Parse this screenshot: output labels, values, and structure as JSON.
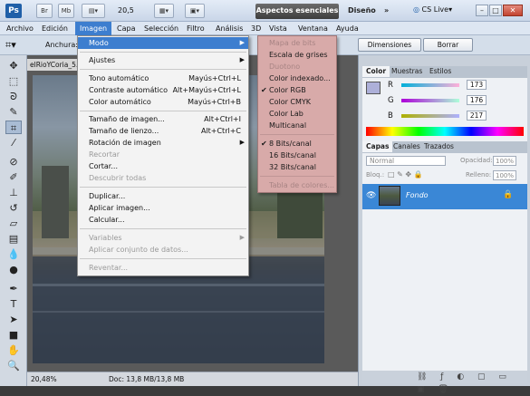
{
  "appbar": {
    "logo": "Ps",
    "btn1": "Br",
    "btn2": "Mb",
    "zoom": "20,5",
    "workspace_active": "Aspectos esenciales",
    "workspace_other": "Diseño",
    "more": "»",
    "cslive": "CS Live"
  },
  "menubar": [
    "Archivo",
    "Edición",
    "Imagen",
    "Capa",
    "Selección",
    "Filtro",
    "Análisis",
    "3D",
    "Vista",
    "Ventana",
    "Ayuda"
  ],
  "options": {
    "anchura_label": "Anchura:",
    "dimensiones": "Dimensiones",
    "borrar": "Borrar"
  },
  "document": {
    "tab_title": "elRioYCoria_5...",
    "zoom_pct": "20,48%",
    "doc_info": "Doc: 13,8 MB/13,8 MB"
  },
  "image_menu": {
    "modo": "Modo",
    "ajustes": "Ajustes",
    "tono": "Tono automático",
    "tono_sc": "Mayús+Ctrl+L",
    "contraste": "Contraste automático",
    "contraste_sc": "Alt+Mayús+Ctrl+L",
    "color": "Color automático",
    "color_sc": "Mayús+Ctrl+B",
    "tam_imagen": "Tamaño de imagen...",
    "tam_imagen_sc": "Alt+Ctrl+I",
    "tam_lienzo": "Tamaño de lienzo...",
    "tam_lienzo_sc": "Alt+Ctrl+C",
    "rotacion": "Rotación de imagen",
    "recortar": "Recortar",
    "cortar": "Cortar...",
    "descubrir": "Descubrir todas",
    "duplicar": "Duplicar...",
    "aplicar_imagen": "Aplicar imagen...",
    "calcular": "Calcular...",
    "variables": "Variables",
    "aplicar_conjunto": "Aplicar conjunto de datos...",
    "reventar": "Reventar..."
  },
  "mode_menu": {
    "mapa_bits": "Mapa de bits",
    "escala_grises": "Escala de grises",
    "duotono": "Duotono",
    "color_indexado": "Color indexado...",
    "rgb": "Color RGB",
    "cmyk": "Color CMYK",
    "lab": "Color Lab",
    "multicanal": "Multicanal",
    "bits8": "8 Bits/canal",
    "bits16": "16 Bits/canal",
    "bits32": "32 Bits/canal",
    "tabla": "Tabla de colores...",
    "check": "✔"
  },
  "color_panel": {
    "tabs": [
      "Color",
      "Muestras",
      "Estilos"
    ],
    "r_label": "R",
    "r_value": "173",
    "g_label": "G",
    "g_value": "176",
    "b_label": "B",
    "b_value": "217",
    "swatch_color": "#adb0d9"
  },
  "layers_panel": {
    "tabs": [
      "Capas",
      "Canales",
      "Trazados"
    ],
    "blend_mode": "Normal",
    "opacity_label": "Opacidad:",
    "opacity_value": "100%",
    "lock_label": "Bloq.:",
    "fill_label": "Relleno:",
    "fill_value": "100%",
    "layer_name": "Fondo"
  },
  "colors": {
    "accent": "#3d7ecf",
    "submenu_bg": "#d8aaa9",
    "layer_selected": "#3a87d6"
  }
}
